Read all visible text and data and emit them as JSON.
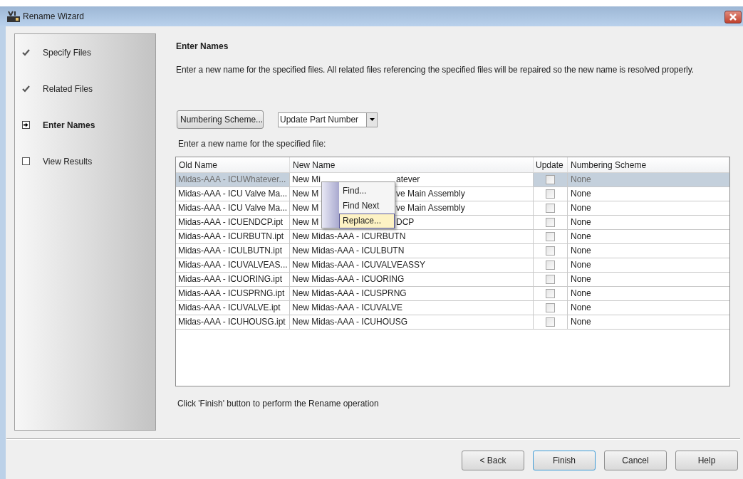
{
  "window": {
    "title": "Rename Wizard"
  },
  "steps": [
    {
      "label": "Specify Files",
      "kind": "done"
    },
    {
      "label": "Related Files",
      "kind": "done"
    },
    {
      "label": "Enter Names",
      "kind": "current"
    },
    {
      "label": "View Results",
      "kind": "pending"
    }
  ],
  "heading": "Enter Names",
  "description": "Enter a new name for the specified files.  All related files referencing the specified files will be repaired so the new name is resolved properly.",
  "numbering_button": "Numbering Scheme...",
  "dropdown": {
    "value": "Update Part Number"
  },
  "table_caption": "Enter a new name for the specified file:",
  "table": {
    "columns": [
      "Old Name",
      "New Name",
      "Update",
      "Numbering Scheme"
    ],
    "rows": [
      {
        "old_name": "Midas-AAA - ICUWhatever...",
        "new_name": "New Mi",
        "new_name_after_menu": "atever",
        "update": false,
        "scheme": "None",
        "selected": true
      },
      {
        "old_name": "Midas-AAA - ICU Valve Ma...",
        "new_name": "New M",
        "new_name_after_menu": "ve Main Assembly",
        "update": false,
        "scheme": "None",
        "selected": false
      },
      {
        "old_name": "Midas-AAA - ICU Valve Ma...",
        "new_name": "New M",
        "new_name_after_menu": "ve Main Assembly",
        "update": false,
        "scheme": "None",
        "selected": false
      },
      {
        "old_name": "Midas-AAA - ICUENDCP.ipt",
        "new_name": "New M",
        "new_name_after_menu": "DCP",
        "update": false,
        "scheme": "None",
        "selected": false
      },
      {
        "old_name": "Midas-AAA - ICURBUTN.ipt",
        "new_name": "New Midas-AAA - ICURBUTN",
        "update": false,
        "scheme": "None",
        "selected": false
      },
      {
        "old_name": "Midas-AAA - ICULBUTN.ipt",
        "new_name": "New Midas-AAA - ICULBUTN",
        "update": false,
        "scheme": "None",
        "selected": false
      },
      {
        "old_name": "Midas-AAA - ICUVALVEAS...",
        "new_name": "New Midas-AAA - ICUVALVEASSY",
        "update": false,
        "scheme": "None",
        "selected": false
      },
      {
        "old_name": "Midas-AAA - ICUORING.ipt",
        "new_name": "New Midas-AAA - ICUORING",
        "update": false,
        "scheme": "None",
        "selected": false
      },
      {
        "old_name": "Midas-AAA - ICUSPRNG.ipt",
        "new_name": "New Midas-AAA - ICUSPRNG",
        "update": false,
        "scheme": "None",
        "selected": false
      },
      {
        "old_name": "Midas-AAA - ICUVALVE.ipt",
        "new_name": "New Midas-AAA - ICUVALVE",
        "update": false,
        "scheme": "None",
        "selected": false
      },
      {
        "old_name": "Midas-AAA - ICUHOUSG.ipt",
        "new_name": "New Midas-AAA - ICUHOUSG",
        "update": false,
        "scheme": "None",
        "selected": false
      }
    ]
  },
  "context_menu": [
    {
      "label": "Find...",
      "selected": false
    },
    {
      "label": "Find Next",
      "selected": false
    },
    {
      "label": "Replace...",
      "selected": true
    }
  ],
  "footer_note": "Click 'Finish' button to perform the Rename operation",
  "buttons": [
    {
      "label": "< Back",
      "kind": "normal"
    },
    {
      "label": "Finish",
      "kind": "default"
    },
    {
      "label": "Cancel",
      "kind": "normal"
    },
    {
      "label": "Help",
      "kind": "normal"
    }
  ]
}
